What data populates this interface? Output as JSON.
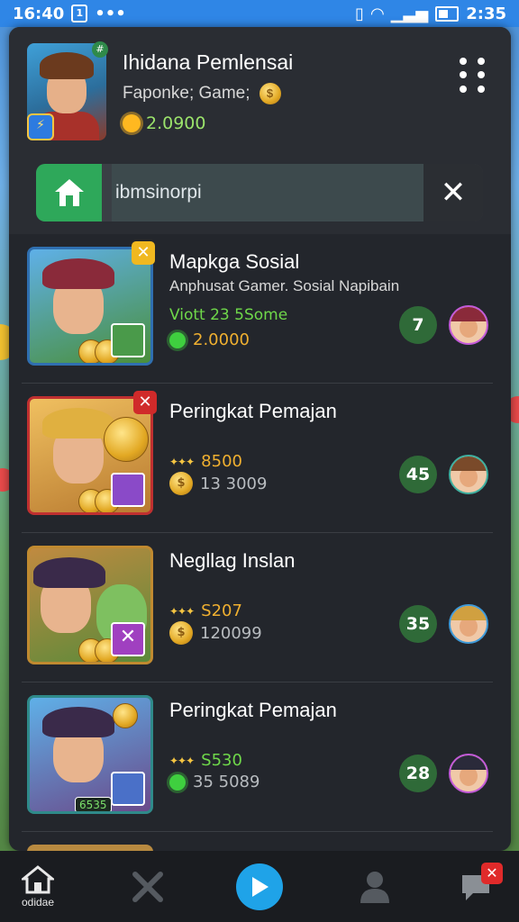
{
  "status_bar": {
    "time_left": "16:40",
    "left_icon_label": "1",
    "dots": "•••",
    "time_right": "2:35"
  },
  "header": {
    "title": "Ihidana Pemlensai",
    "subtitle": "Faponke; Game;",
    "coins": "2.0900",
    "hero_badge": "⚡",
    "hero_corner": "#"
  },
  "search": {
    "value": "ibmsinorpi",
    "close_label": "✕"
  },
  "items": [
    {
      "title": "Mapkga Sosial",
      "subtitle": "Anphusat Gamer. Sosial Napibain",
      "green_text": "Viott 23 5Some",
      "stat1": "",
      "stat2": "2.0000",
      "rank": "7",
      "badge": "✕"
    },
    {
      "title": "Peringkat Pemajan",
      "subtitle": "",
      "green_text": "",
      "stat1": "8500",
      "stat2": "13 3009",
      "rank": "45",
      "badge": "✕"
    },
    {
      "title": "Negllag Inslan",
      "subtitle": "",
      "green_text": "",
      "stat1": "S207",
      "stat2": "120099",
      "rank": "35",
      "badge": ""
    },
    {
      "title": "Peringkat Pemajan",
      "subtitle": "",
      "green_text": "",
      "stat1": "S530",
      "stat2": "35 5089",
      "rank": "28",
      "badge": "",
      "thumb_label": "6535"
    }
  ],
  "bottom_nav": {
    "home_label": "odidae",
    "notif_badge": "✕"
  },
  "colors": {
    "accent_green": "#2ea85a",
    "play_blue": "#1fa3e8",
    "rank_green": "#2f6a38",
    "gold": "#f0b030"
  }
}
